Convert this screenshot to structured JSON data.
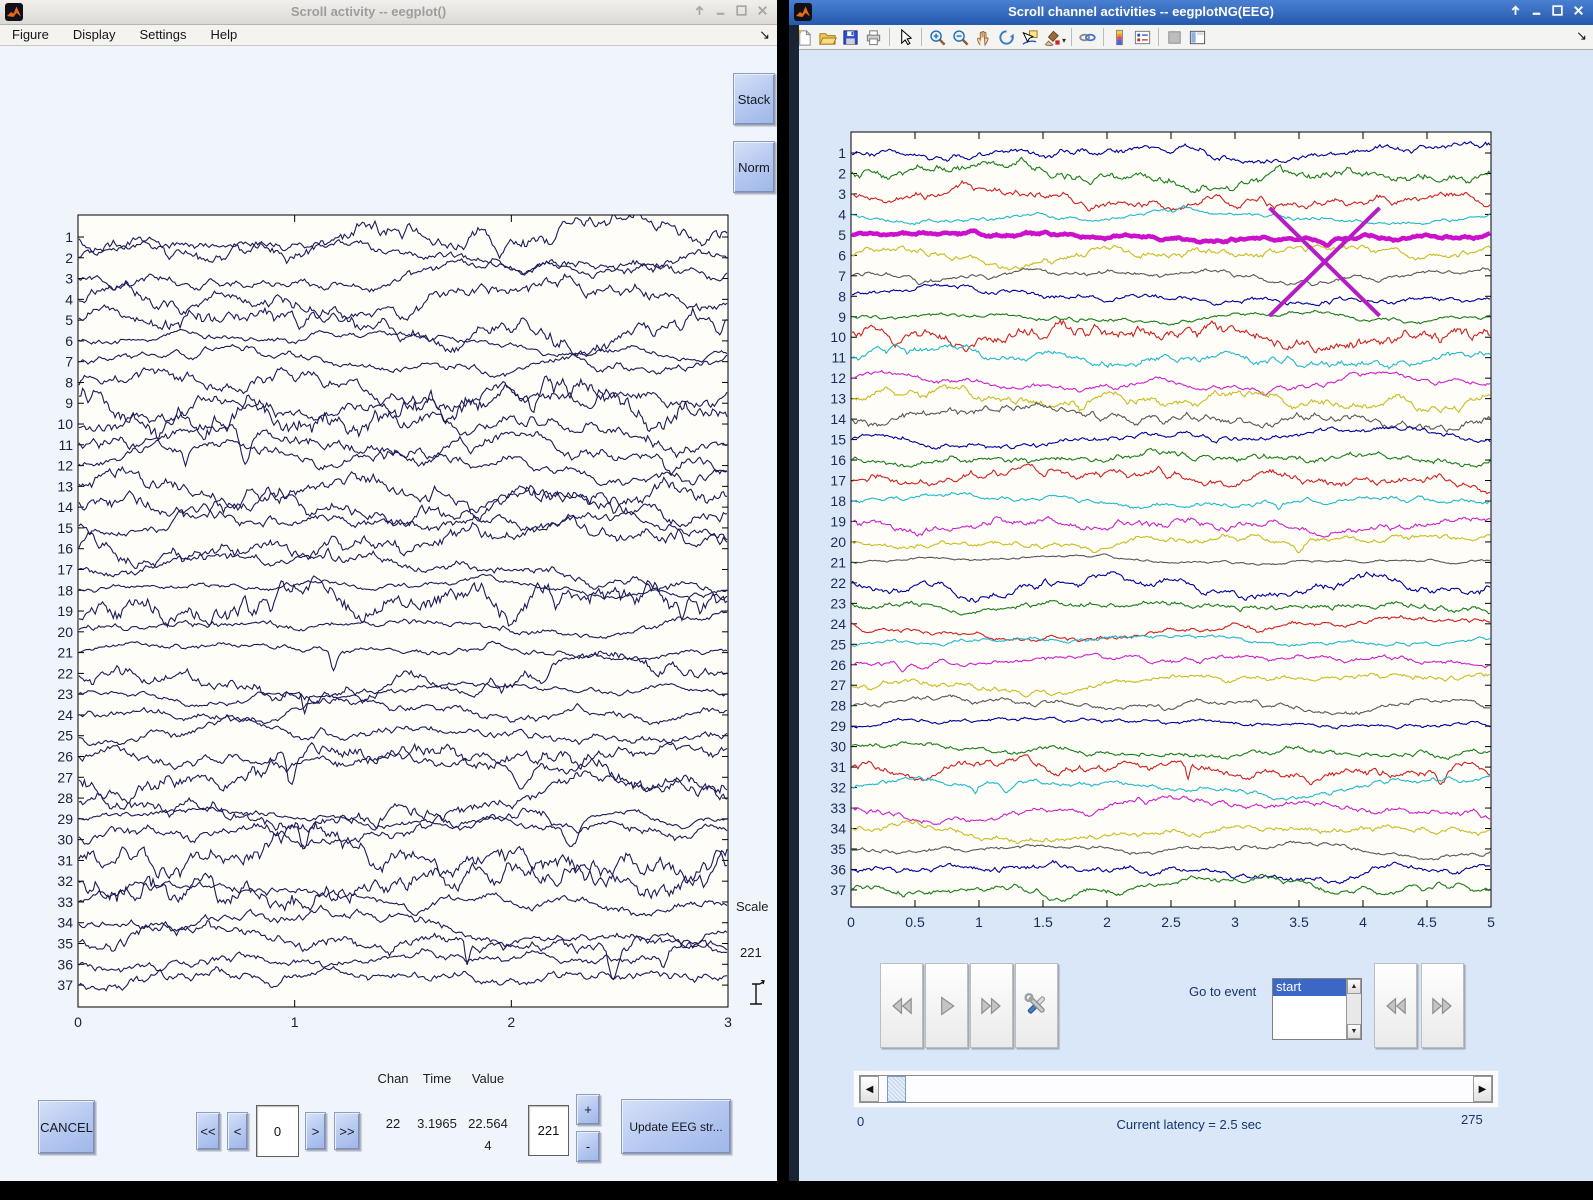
{
  "left_window": {
    "title": "Scroll activity -- eegplot()",
    "titlebar_controls": [
      "up",
      "minimize",
      "maximize",
      "close"
    ],
    "menu_items": [
      "Figure",
      "Display",
      "Settings",
      "Help"
    ],
    "dock_arrow": "↘",
    "stack_button": "Stack",
    "norm_button": "Norm",
    "scale_label": "Scale",
    "scale_value": "221",
    "cancel_button": "CANCEL",
    "nav_buttons": {
      "fast_back": "<<",
      "back": "<",
      "fwd": ">",
      "fast_fwd": ">>"
    },
    "position_field": "0",
    "readout": {
      "headers": [
        "Chan",
        "Time",
        "Value"
      ],
      "chan": "22",
      "time": "3.1965",
      "value_line1": "22.564",
      "value_line2": "4"
    },
    "scale_edit": "221",
    "plus_button": "+",
    "minus_button": "-",
    "update_button": "Update EEG str..."
  },
  "right_window": {
    "title": "Scroll channel activities -- eegplotNG(EEG)",
    "titlebar_controls": [
      "up",
      "minimize",
      "maximize",
      "close"
    ],
    "toolbar_icons": [
      "new-file",
      "open-folder",
      "save",
      "print",
      "sep",
      "cursor-arrow",
      "sep",
      "zoom-in",
      "zoom-out",
      "pan-hand",
      "rotate-3d",
      "data-cursor",
      "brush",
      "dropdown-caret",
      "sep",
      "link-plot",
      "sep",
      "insert-colorbar",
      "insert-legend",
      "sep",
      "hide-plot-tools",
      "show-plot-tools"
    ],
    "dock_arrow": "↘",
    "goto_event_label": "Go to event",
    "event_list": [
      "start"
    ],
    "selected_event": "start",
    "scroll_min": "0",
    "scroll_max": "275",
    "latency_text": "Current latency = 2.5 sec"
  },
  "chart_data": [
    {
      "type": "line",
      "panel": "left-eegplot",
      "n_channels": 37,
      "channel_labels": [
        "1",
        "2",
        "3",
        "4",
        "5",
        "6",
        "7",
        "8",
        "9",
        "10",
        "11",
        "12",
        "13",
        "14",
        "15",
        "16",
        "17",
        "18",
        "19",
        "20",
        "21",
        "22",
        "23",
        "24",
        "25",
        "26",
        "27",
        "28",
        "29",
        "30",
        "31",
        "32",
        "33",
        "34",
        "35",
        "36",
        "37"
      ],
      "x_range": [
        0,
        3
      ],
      "x_tick_labels": [
        "0",
        "1",
        "2",
        "3"
      ],
      "line_color": "#1b1b5a",
      "waveform": "dense stochastic EEG noise traces, one per channel, heavily overlapping"
    },
    {
      "type": "line",
      "panel": "right-eegplotNG",
      "n_channels": 37,
      "channel_labels": [
        "1",
        "2",
        "3",
        "4",
        "5",
        "6",
        "7",
        "8",
        "9",
        "10",
        "11",
        "12",
        "13",
        "14",
        "15",
        "16",
        "17",
        "18",
        "19",
        "20",
        "21",
        "22",
        "23",
        "24",
        "25",
        "26",
        "27",
        "28",
        "29",
        "30",
        "31",
        "32",
        "33",
        "34",
        "35",
        "36",
        "37"
      ],
      "x_range": [
        0,
        5
      ],
      "x_tick_labels": [
        "0",
        "0.5",
        "1",
        "1.5",
        "2",
        "2.5",
        "3",
        "3.5",
        "4",
        "4.5",
        "5"
      ],
      "color_cycle": [
        "#00009c",
        "#1a7d1a",
        "#cc2222",
        "#22b8cc",
        "#cc22cc",
        "#c8bd22",
        "#595959"
      ],
      "highlight_channel": 5,
      "highlight_color": "#cc11cc",
      "cursor_x_mark": {
        "time": 3.7,
        "channel": 5,
        "color": "#b51cc4"
      },
      "waveform": "stochastic EEG noise traces colored in repeating 7-color cycle; channel 5 drawn thick (selected)"
    }
  ]
}
